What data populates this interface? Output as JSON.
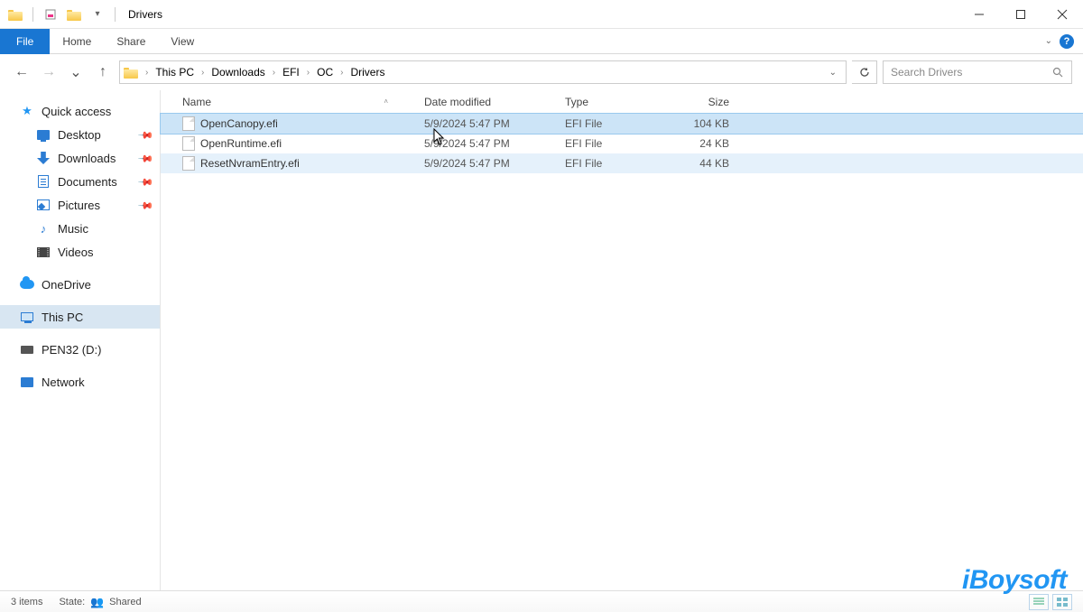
{
  "window": {
    "title": "Drivers"
  },
  "ribbon": {
    "file": "File",
    "tabs": [
      "Home",
      "Share",
      "View"
    ]
  },
  "breadcrumbs": [
    "This PC",
    "Downloads",
    "EFI",
    "OC",
    "Drivers"
  ],
  "search": {
    "placeholder": "Search Drivers"
  },
  "columns": {
    "name": "Name",
    "date": "Date modified",
    "type": "Type",
    "size": "Size"
  },
  "sidebar": {
    "quick_access": "Quick access",
    "desktop": "Desktop",
    "downloads": "Downloads",
    "documents": "Documents",
    "pictures": "Pictures",
    "music": "Music",
    "videos": "Videos",
    "onedrive": "OneDrive",
    "this_pc": "This PC",
    "pen32": "PEN32 (D:)",
    "network": "Network"
  },
  "files": [
    {
      "name": "OpenCanopy.efi",
      "date": "5/9/2024 5:47 PM",
      "type": "EFI File",
      "size": "104 KB",
      "selected": true
    },
    {
      "name": "OpenRuntime.efi",
      "date": "5/9/2024 5:47 PM",
      "type": "EFI File",
      "size": "24 KB",
      "selected": false
    },
    {
      "name": "ResetNvramEntry.efi",
      "date": "5/9/2024 5:47 PM",
      "type": "EFI File",
      "size": "44 KB",
      "selected": false,
      "highlight": true
    }
  ],
  "status": {
    "items": "3 items",
    "state_label": "State:",
    "state_value": "Shared"
  },
  "watermark": "iBoysoft"
}
